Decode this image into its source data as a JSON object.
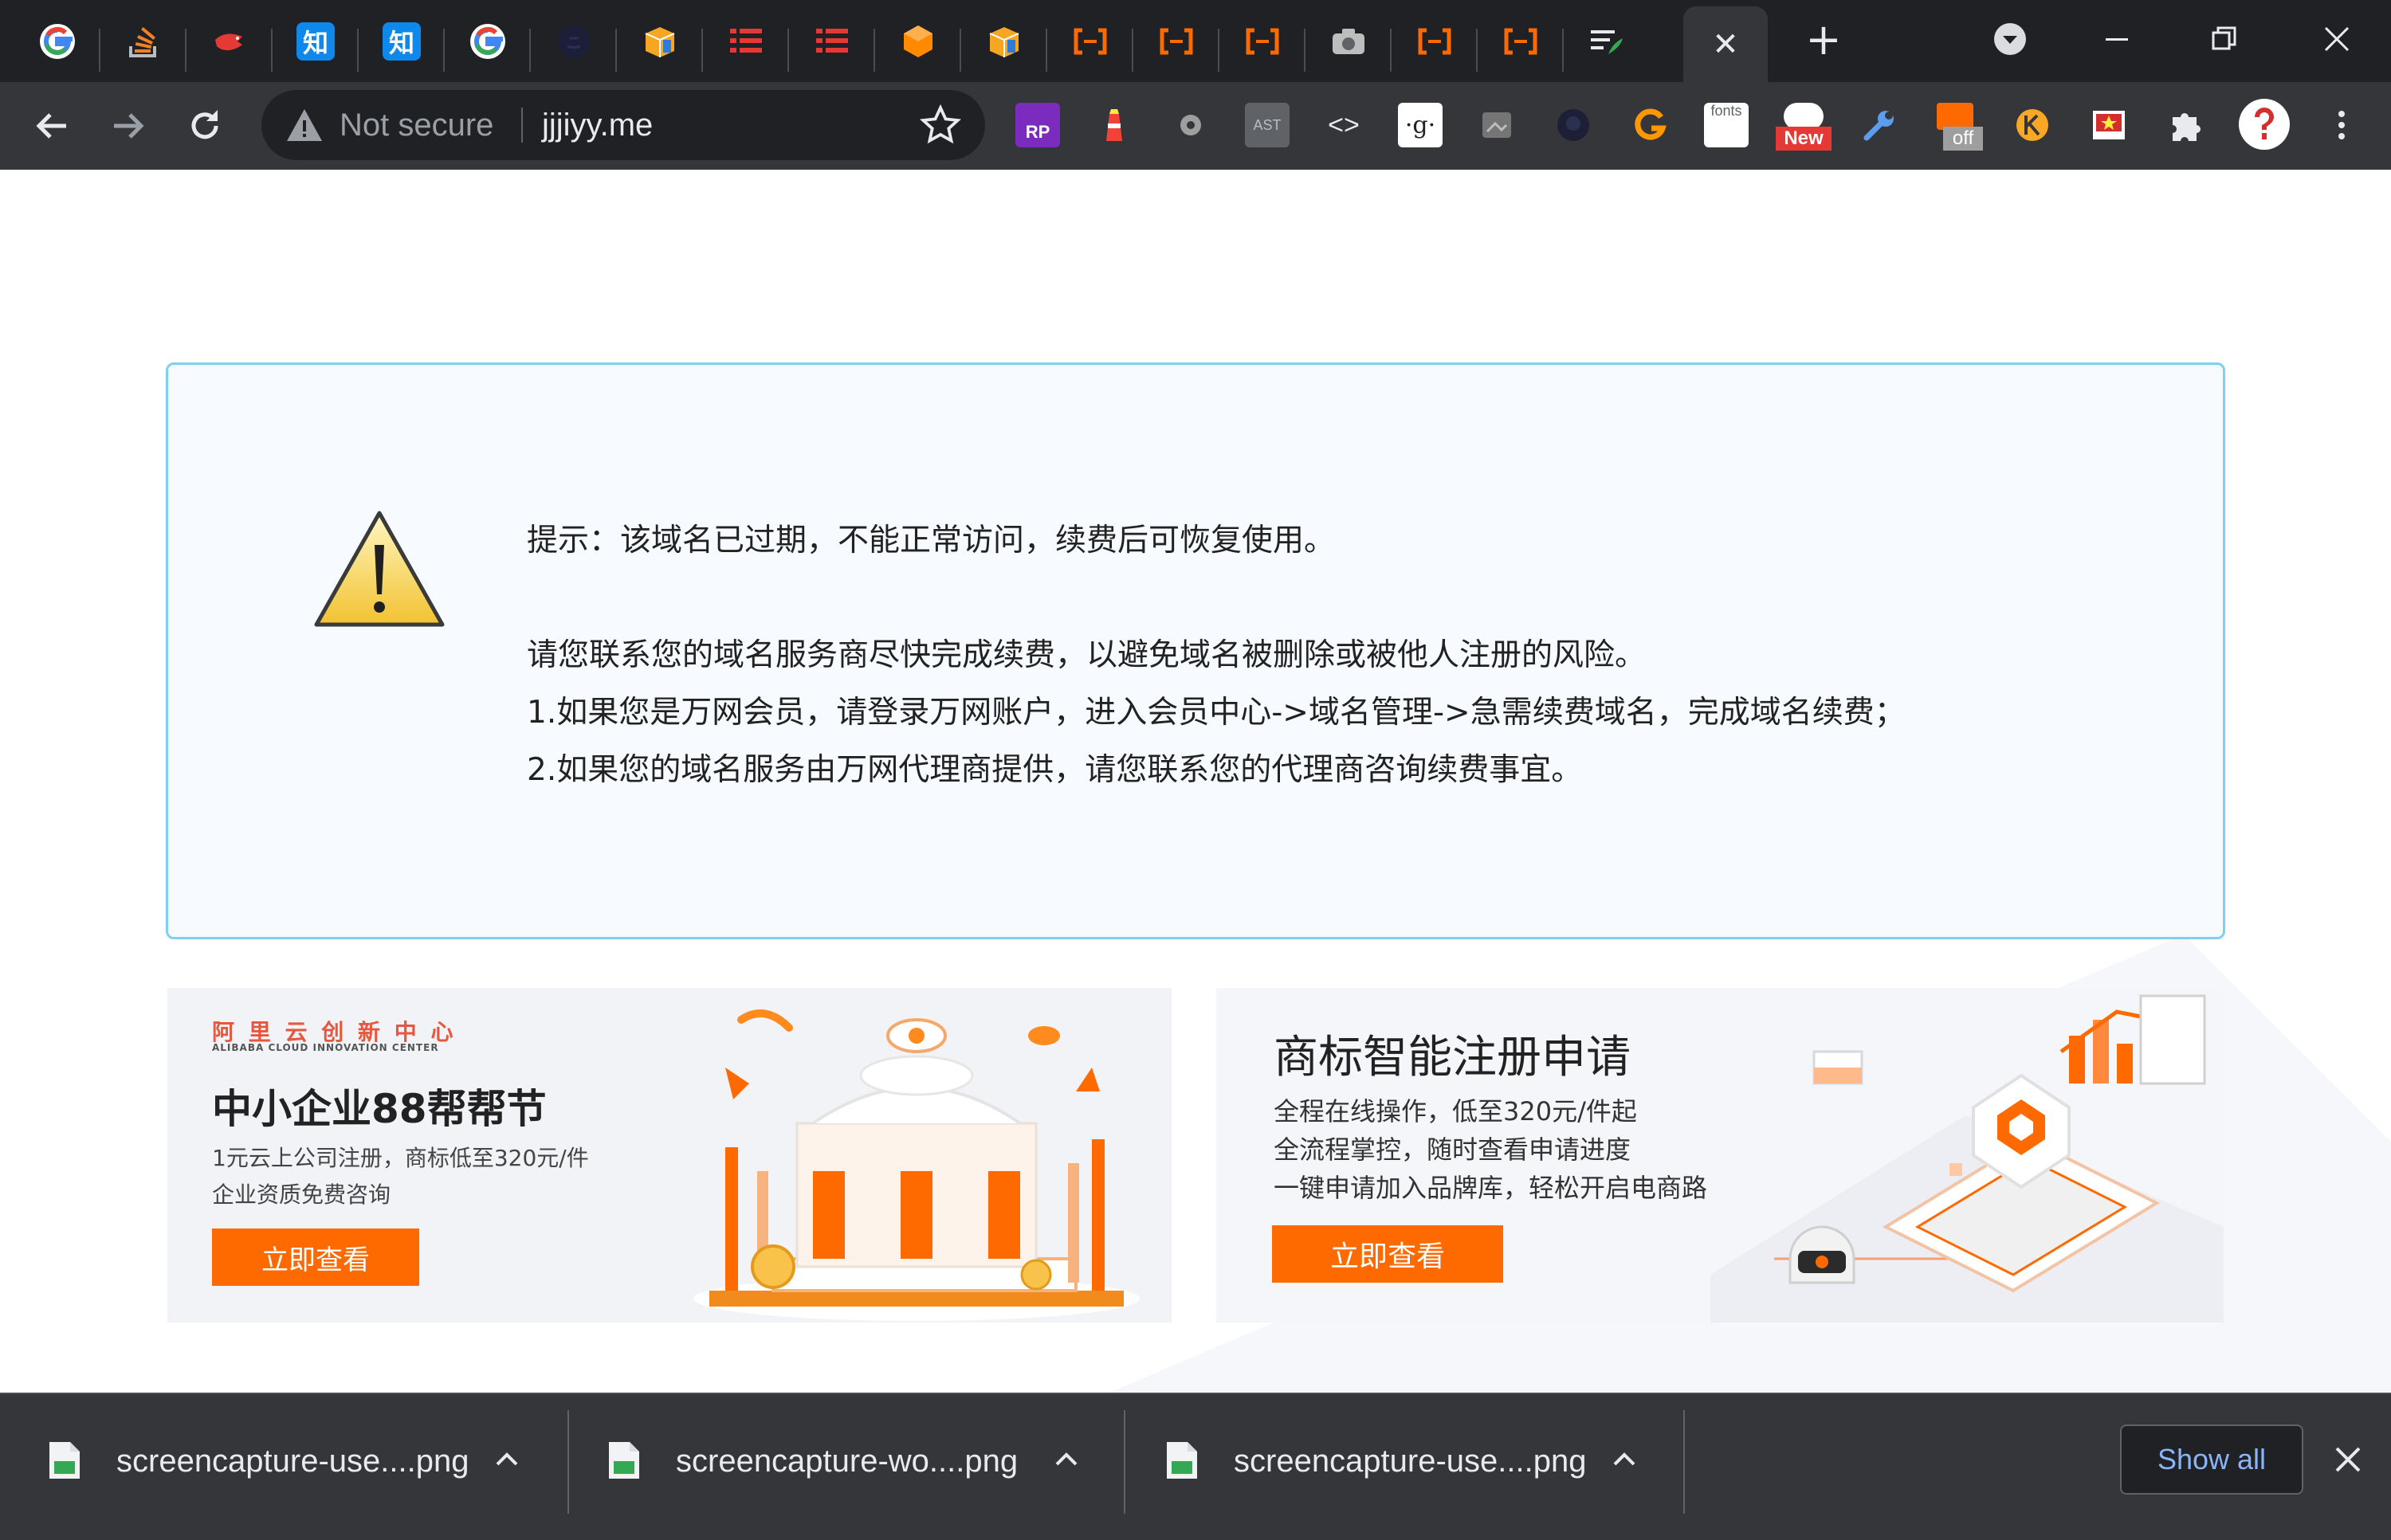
{
  "browser": {
    "tabs": [
      {
        "icon": "google-icon"
      },
      {
        "icon": "stackoverflow-icon"
      },
      {
        "icon": "red-bird-icon"
      },
      {
        "icon": "zhihu-icon",
        "glyph": "知"
      },
      {
        "icon": "zhihu-icon",
        "glyph": "知"
      },
      {
        "icon": "google-icon"
      },
      {
        "icon": "github-icon"
      },
      {
        "icon": "orange-box-icon"
      },
      {
        "icon": "red-list-icon"
      },
      {
        "icon": "red-list-icon"
      },
      {
        "icon": "orange-cube-icon"
      },
      {
        "icon": "orange-box-icon"
      },
      {
        "icon": "bracket-icon"
      },
      {
        "icon": "bracket-icon"
      },
      {
        "icon": "bracket-icon"
      },
      {
        "icon": "camera-icon"
      },
      {
        "icon": "bracket-icon"
      },
      {
        "icon": "bracket-icon"
      },
      {
        "icon": "feather-list-icon"
      }
    ],
    "active_tab_close": "✕",
    "new_tab": "+",
    "omnibox": {
      "security_label": "Not secure",
      "url": "jjjiyy.me"
    },
    "extensions": [
      {
        "icon": "rp-icon",
        "label": "RP"
      },
      {
        "icon": "lighthouse-icon"
      },
      {
        "icon": "puzzle-gear-icon"
      },
      {
        "icon": "ast-icon",
        "label": "AST"
      },
      {
        "icon": "code-icon",
        "label": "<>"
      },
      {
        "icon": "g-icon",
        "label": "·g·"
      },
      {
        "icon": "screenshot-icon"
      },
      {
        "icon": "github-octocat-icon"
      },
      {
        "icon": "orange-g-icon"
      },
      {
        "icon": "fonts-icon",
        "label": "fonts"
      },
      {
        "icon": "new-badge-icon",
        "label": "New"
      },
      {
        "icon": "wrench-icon"
      },
      {
        "icon": "off-badge-icon",
        "label": "off"
      },
      {
        "icon": "yellow-k-icon"
      },
      {
        "icon": "red-star-icon"
      },
      {
        "icon": "extensions-puzzle-icon"
      },
      {
        "icon": "profile-avatar-icon"
      },
      {
        "icon": "menu-dots-icon"
      }
    ],
    "colors": {
      "tab_strip": "#202124",
      "toolbar": "#35363a",
      "accent_blue": "#8ab4f8"
    }
  },
  "notice": {
    "line1": "提示：该域名已过期，不能正常访问，续费后可恢复使用。",
    "line2": "请您联系您的域名服务商尽快完成续费，以避免域名被删除或被他人注册的风险。",
    "line3": "1.如果您是万网会员，请登录万网账户，进入会员中心->域名管理->急需续费域名，完成域名续费；",
    "line4": "2.如果您的域名服务由万网代理商提供，请您联系您的代理商咨询续费事宜。",
    "border_color": "#7fd0ee"
  },
  "banners": {
    "left": {
      "brand_cn": "阿 里 云 创 新 中 心",
      "brand_en": "ALIBABA CLOUD INNOVATION CENTER",
      "title": "中小企业88帮帮节",
      "desc1": "1元云上公司注册，商标低至320元/件",
      "desc2": "企业资质免费咨询",
      "button": "立即查看"
    },
    "right": {
      "title": "商标智能注册申请",
      "desc1": "全程在线操作，低至320元/件起",
      "desc2": "全流程掌控，随时查看申请进度",
      "desc3": "一键申请加入品牌库，轻松开启电商路",
      "button": "立即查看"
    },
    "accent": "#ff6a00"
  },
  "downloads": {
    "items": [
      {
        "name": "screencapture-use....png"
      },
      {
        "name": "screencapture-wo....png"
      },
      {
        "name": "screencapture-use....png"
      }
    ],
    "show_all": "Show all"
  }
}
